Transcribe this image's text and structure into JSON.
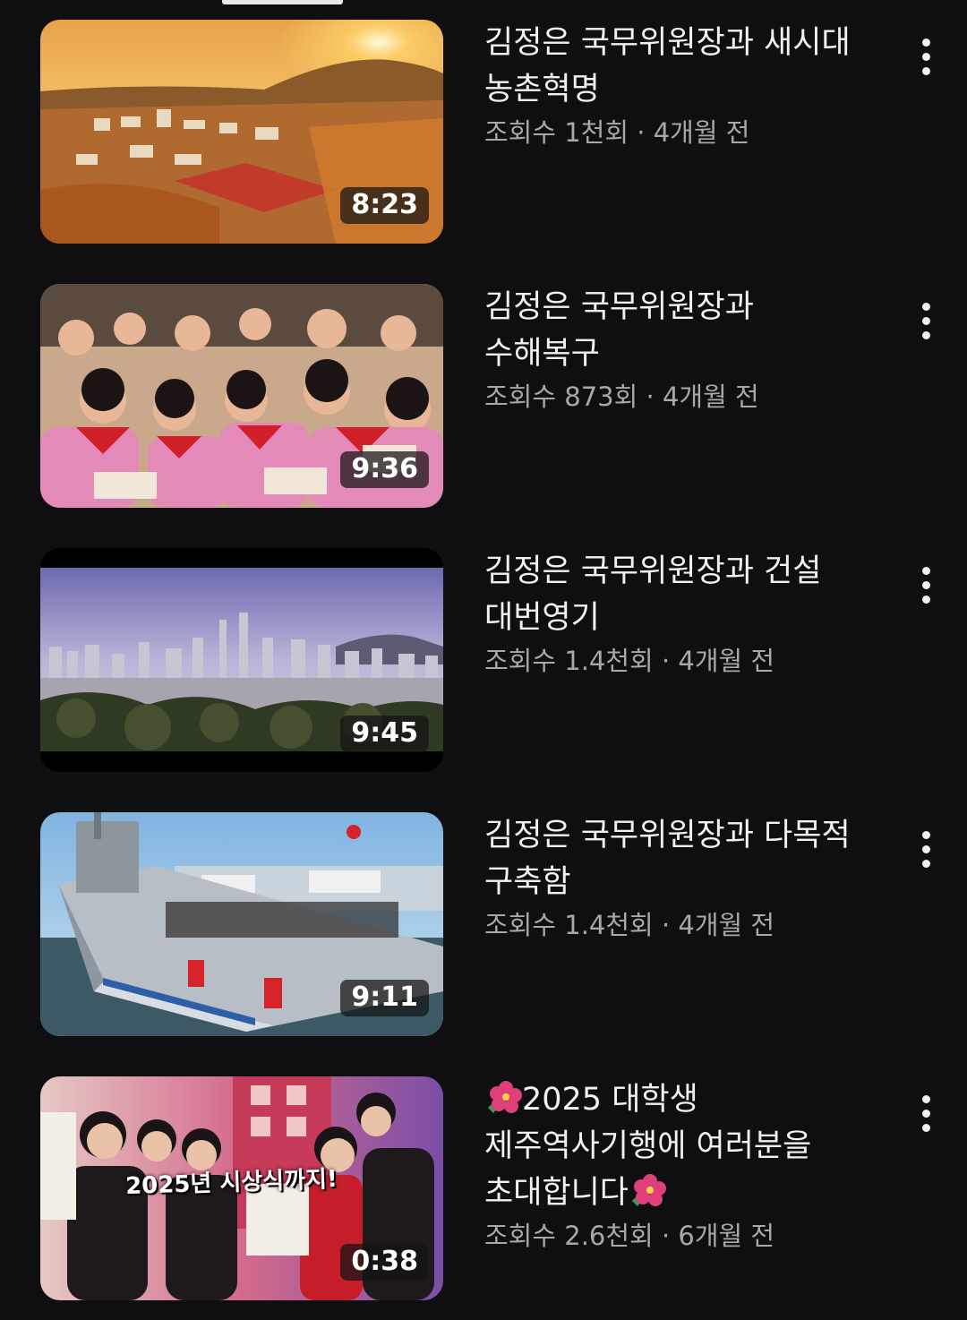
{
  "videos": [
    {
      "title": "김정은 국무위원장과 새시대\n농촌혁명",
      "views": "조회수 1천회",
      "age": "4개월 전",
      "duration": "8:23",
      "thumb_icon": "rural-town-sunset-thumbnail"
    },
    {
      "title": "김정은 국무위원장과\n수해복구",
      "views": "조회수 873회",
      "age": "4개월 전",
      "duration": "9:36",
      "thumb_icon": "children-gathering-thumbnail"
    },
    {
      "title": "김정은 국무위원장과 건설\n대번영기",
      "views": "조회수 1.4천회",
      "age": "4개월 전",
      "duration": "9:45",
      "thumb_icon": "city-skyline-thumbnail"
    },
    {
      "title": "김정은 국무위원장과 다목적\n구축함",
      "views": "조회수 1.4천회",
      "age": "4개월 전",
      "duration": "9:11",
      "thumb_icon": "warship-launch-thumbnail"
    },
    {
      "title_prefix_icon": "hibiscus-emoji",
      "title_line1": "2025 대학생",
      "title_line2": "제주역사기행에 여러분을",
      "title_line3": "초대합니다",
      "title_suffix_icon": "hibiscus-emoji",
      "views": "조회수 2.6천회",
      "age": "6개월 전",
      "duration": "0:38",
      "thumb_overlay_text": "2025년 시상식까지!",
      "thumb_icon": "students-celebrating-thumbnail"
    }
  ],
  "meta_separator": " · ",
  "colors": {
    "background": "#0f0e10",
    "title": "#f1f1f1",
    "meta": "#a8a8a8"
  }
}
